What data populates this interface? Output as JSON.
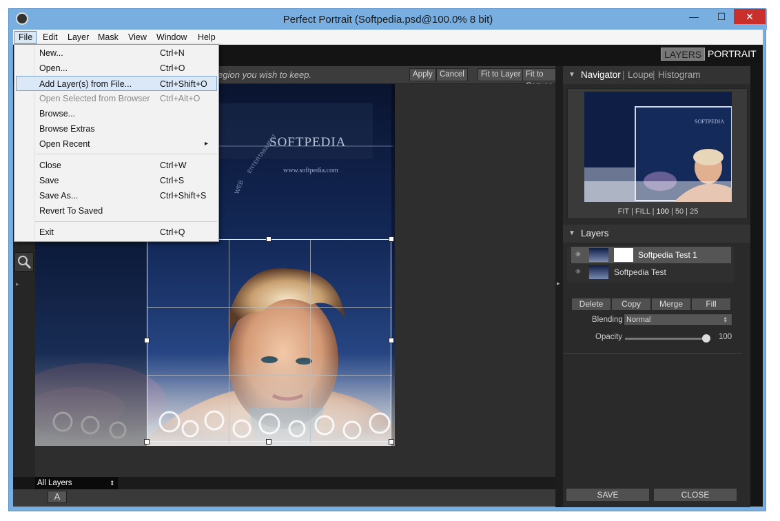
{
  "window": {
    "title": "Perfect Portrait (Softpedia.psd@100.0% 8 bit)",
    "minimize_glyph": "—",
    "maximize_glyph": "☐",
    "close_glyph": "✕",
    "colors": {
      "frame": "#78aee0",
      "close": "#c9302c"
    }
  },
  "menubar": [
    "File",
    "Edit",
    "Layer",
    "Mask",
    "View",
    "Window",
    "Help"
  ],
  "file_menu": {
    "items": [
      {
        "label": "New...",
        "shortcut": "Ctrl+N"
      },
      {
        "label": "Open...",
        "shortcut": "Ctrl+O"
      },
      {
        "label": "Add Layer(s) from File...",
        "shortcut": "Ctrl+Shift+O"
      },
      {
        "label": "Open Selected from Browser",
        "shortcut": "Ctrl+Alt+O"
      },
      {
        "label": "Browse...",
        "shortcut": ""
      },
      {
        "label": "Browse Extras",
        "shortcut": ""
      },
      {
        "label": "Open Recent",
        "shortcut": "▸"
      },
      {
        "label": "Close",
        "shortcut": "Ctrl+W"
      },
      {
        "label": "Save",
        "shortcut": "Ctrl+S"
      },
      {
        "label": "Save As...",
        "shortcut": "Ctrl+Shift+S"
      },
      {
        "label": "Revert To Saved",
        "shortcut": ""
      },
      {
        "label": "Exit",
        "shortcut": "Ctrl+Q"
      }
    ],
    "highlighted": "Add Layer(s) from File...",
    "disabled": "Open Selected from Browser"
  },
  "mode_tabs": {
    "layers": "LAYERS",
    "portrait": "PORTRAIT"
  },
  "toolbar": {
    "hint": "e region you wish to keep.",
    "apply": "Apply",
    "cancel": "Cancel",
    "fit_layer": "Fit to Layer",
    "fit_canvas": "Fit to Canvas"
  },
  "canvas_art": {
    "logo": "SOFTPEDIA",
    "url": "www.softpedia.com",
    "web": "WEB",
    "ent": "ENTERTAINMENT"
  },
  "bottom": {
    "layer_select": "All Layers",
    "text_tool": "A"
  },
  "navigator": {
    "tabs": [
      "Navigator",
      "Loupe",
      "Histogram"
    ],
    "thumb_logo": "SOFTPEDIA",
    "zoom_options": [
      "FIT",
      "FILL",
      "100",
      "50",
      "25"
    ],
    "zoom_selected": "100"
  },
  "layers": {
    "title": "Layers",
    "items": [
      {
        "name": "Softpedia Test 1",
        "selected": true
      },
      {
        "name": "Softpedia Test",
        "selected": false
      }
    ],
    "buttons": [
      "Delete",
      "Copy",
      "Merge",
      "Fill"
    ],
    "blending_label": "Blending",
    "blending_value": "Normal",
    "opacity_label": "Opacity",
    "opacity_value": "100"
  },
  "footer": {
    "save": "SAVE",
    "close": "CLOSE"
  }
}
